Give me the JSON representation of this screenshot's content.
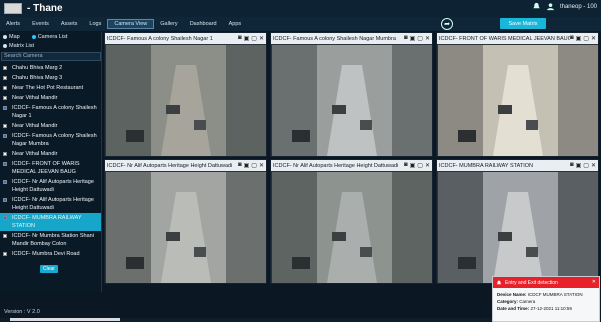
{
  "header": {
    "title": "- Thane",
    "user": "thaneop - 100"
  },
  "nav": {
    "items": [
      "Alerts",
      "Events",
      "Assets",
      "Logs",
      "Camera View",
      "Gallery",
      "Dashboard",
      "Apps"
    ]
  },
  "toolbar": {
    "save_label": "Save Matrix"
  },
  "sidebar": {
    "radio_map": "Map",
    "radio_camlist": "Camera List",
    "radio_matrix": "Matrix List",
    "search_placeholder": "Search Camera",
    "cameras": [
      {
        "label": "Chahu Bhiva Marg 2",
        "checked": false
      },
      {
        "label": "Chahu Bhiva Marg 3",
        "checked": false
      },
      {
        "label": "Near The Hot Pot Restaurant",
        "checked": false
      },
      {
        "label": "Near Vithal Mandir",
        "checked": false
      },
      {
        "label": "ICDCF- Famous A colony Shailesh Nagar 1",
        "checked": true
      },
      {
        "label": "Near Vithal Mandir",
        "checked": false
      },
      {
        "label": "ICDCF- Famous A colony Shailesh Nagar Mumbra",
        "checked": true
      },
      {
        "label": "Near Vithal Mandir",
        "checked": false
      },
      {
        "label": "ICDCF- FRONT OF WARIS MEDICAL JEEVAN BAUG",
        "checked": true
      },
      {
        "label": "ICDCF- Nr Alif Autoparts Heritage Height Dattuwadi",
        "checked": true
      },
      {
        "label": "ICDCF- Nr Alif Autoparts Heritage Height Dattuwadi",
        "checked": true
      },
      {
        "label": "ICDCF- MUMBRA RAILWAY STATION",
        "checked": true
      },
      {
        "label": "ICDCF- Nr Mumbra Station Shani Mandir Bombay Colon",
        "checked": false
      },
      {
        "label": "ICDCF- Mumbra Devi Road",
        "checked": false
      }
    ],
    "clear_label": "Clear"
  },
  "tiles": [
    {
      "title": "ICDCF- Famous A colony Shailesh Nagar 1"
    },
    {
      "title": "ICDCF- Famous A colony Shailesh Nagar Mumbra"
    },
    {
      "title": "ICDCF- FRONT OF WARIS MEDICAL JEEVAN BAUG"
    },
    {
      "title": "ICDCF- Nr Alif Autoparts Heritage Height Dattuwadi"
    },
    {
      "title": "ICDCF- Nr Alif Autoparts Heritage Height Dattuwadi"
    },
    {
      "title": "ICDCF- MUMBRA RAILWAY STATION"
    }
  ],
  "alert": {
    "title": "Entry and Exit detection",
    "device_label": "Device Name:",
    "device_value": "ICDCF MUMBRA STATION",
    "category_label": "Category:",
    "category_value": "Camera",
    "datetime_label": "Date and Time:",
    "datetime_value": "27-12-2021 11:10:59"
  },
  "footer": {
    "version": "Version : V 2.0"
  },
  "colors": {
    "accent": "#18b6d8",
    "alert": "#e8202a",
    "bg": "#0b1722"
  }
}
